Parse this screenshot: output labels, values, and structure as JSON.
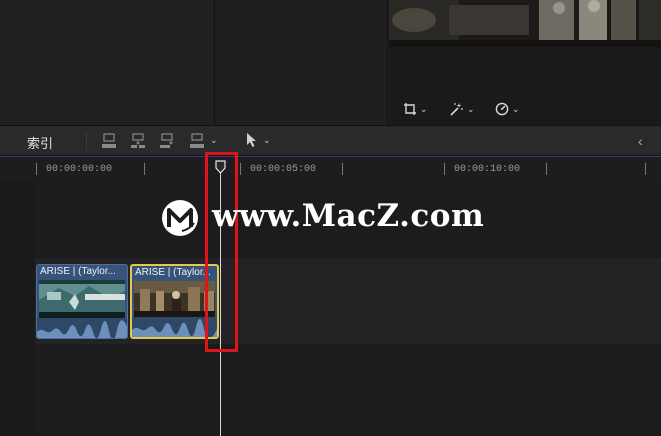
{
  "timeline_toolbar": {
    "index_label": "索引"
  },
  "ruler": {
    "timecodes": [
      "00:00:00:00",
      "00:00:05:00",
      "00:00:10:00"
    ]
  },
  "clips": [
    {
      "title": "ARISE | (Taylor...",
      "selected": false
    },
    {
      "title": "ARISE | (Taylor...",
      "selected": true
    }
  ],
  "watermark": {
    "text": "www.MacZ.com"
  },
  "icons": {
    "crop": "crop-icon",
    "effects": "magic-wand-icon",
    "retime": "speedometer-icon",
    "connect": "connect-clip-icon",
    "insert": "insert-clip-icon",
    "append": "append-clip-icon",
    "overwrite": "overwrite-clip-icon",
    "select_tool": "arrow-pointer-icon",
    "collapse": "chevron-left-icon"
  },
  "colors": {
    "selection_outline": "#e5c84a",
    "clip_fill": "#36537a",
    "highlight_box": "#e0121a",
    "ruler_accent": "#3f3a7a"
  }
}
